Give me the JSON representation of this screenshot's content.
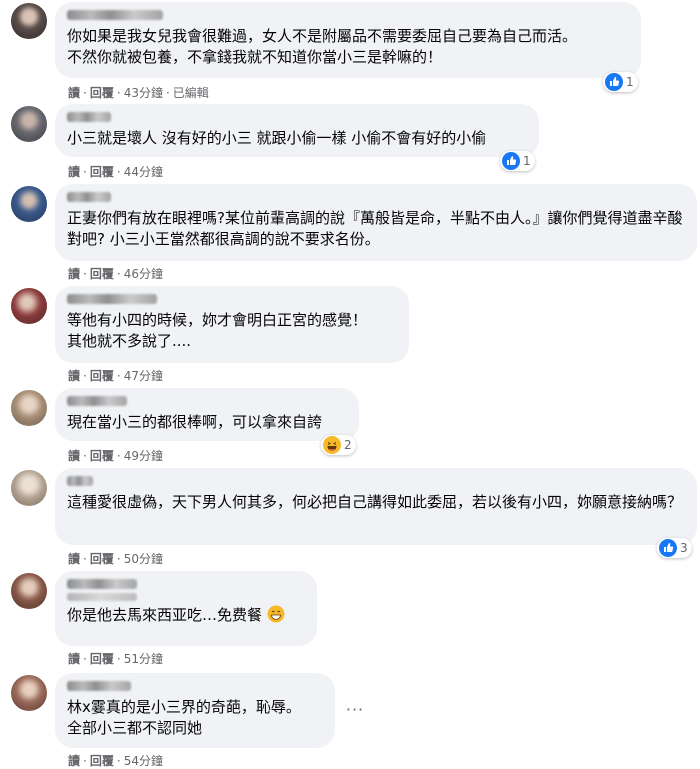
{
  "action_labels": {
    "read": "讀",
    "reply": "回覆",
    "dot": "·",
    "edited": "已編輯"
  },
  "comments": [
    {
      "text": "你如果是我女兒我會很難過，女人不是附屬品不需要委屈自己要為自己而活。\n不然你就被包養，不拿錢我就不知道你當小三是幹嘛的！",
      "time": "43分鐘",
      "edited": true,
      "reaction": {
        "type": "like-icon",
        "count": "1"
      },
      "avatar_color": "#5a4e4a"
    },
    {
      "text": "小三就是壞人 沒有好的小三 就跟小偷一樣 小偷不會有好的小偷",
      "time": "44分鐘",
      "reaction": {
        "type": "like-icon",
        "count": "1"
      },
      "avatar_color": "#6a6a72"
    },
    {
      "text": "正妻你們有放在眼裡嗎?某位前輩高調的說『萬般皆是命，半點不由人。』讓你們覺得道盡辛酸對吧? 小三小王當然都很高調的說不要求名份。",
      "time": "46分鐘",
      "avatar_color": "#3b5a8c"
    },
    {
      "text": "等他有小四的時候，妳才會明白正宮的感覺！\n其他就不多說了....",
      "time": "47分鐘",
      "avatar_color": "#8c3a3a"
    },
    {
      "text": "現在當小三的都很棒啊，可以拿來自誇",
      "time": "49分鐘",
      "reaction": {
        "type": "laugh-emoji-icon",
        "count": "2"
      },
      "avatar_color": "#a89078"
    },
    {
      "text": "這種愛很虛偽，天下男人何其多，何必把自己講得如此委屈，若以後有小四，妳願意接納嗎？",
      "time": "50分鐘",
      "reaction": {
        "type": "like-icon",
        "count": "3"
      },
      "avatar_color": "#b0a090"
    },
    {
      "text": "你是他去馬來西亚吃…免费餐",
      "time": "51分鐘",
      "avatar_color": "#8a5a4a"
    },
    {
      "text": "林x霎真的是小三界的奇葩，恥辱。\n全部小三都不認同她",
      "time": "54分鐘",
      "more_label": "···",
      "avatar_color": "#9a6a5a"
    }
  ],
  "colors": {
    "bubble": "#f0f2f5",
    "meta": "#65676b",
    "like_blue": "#1877f2",
    "laugh_yellow": "#f7b928"
  }
}
